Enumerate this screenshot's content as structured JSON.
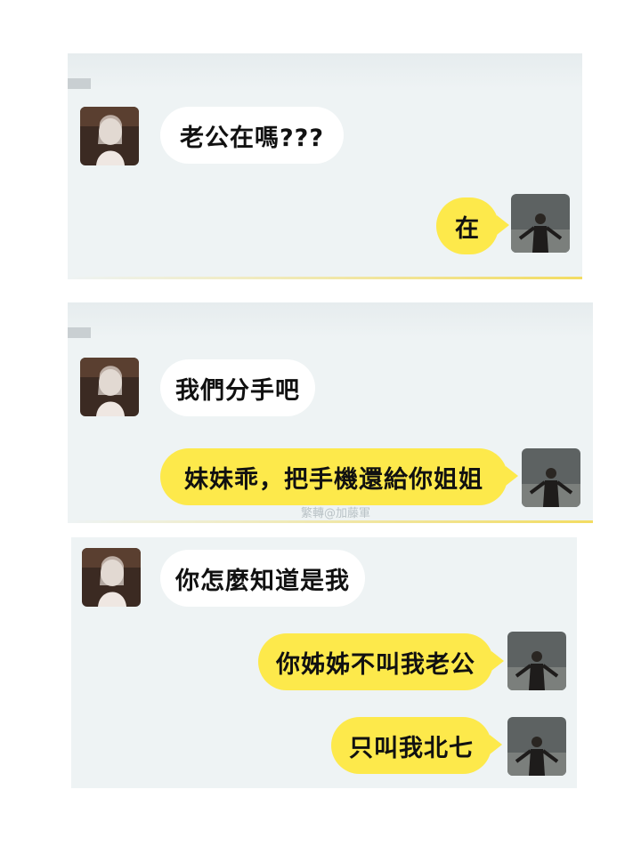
{
  "panels": [
    {
      "messages": [
        {
          "side": "left",
          "text": "老公在嗎???"
        },
        {
          "side": "right",
          "text": "在"
        }
      ]
    },
    {
      "messages": [
        {
          "side": "left",
          "text": "我們分手吧"
        },
        {
          "side": "right",
          "text": "妹妹乖，把手機還給你姐姐"
        }
      ]
    },
    {
      "messages": [
        {
          "side": "left",
          "text": "你怎麼知道是我"
        },
        {
          "side": "right",
          "text": "你姊姊不叫我老公"
        },
        {
          "side": "right",
          "text": "只叫我北七"
        }
      ]
    }
  ],
  "watermark": "繁轉@加藤軍",
  "colors": {
    "panel_bg": "#eef3f4",
    "bubble_self": "#fde94b",
    "bubble_other": "#ffffff"
  },
  "icons": {
    "left_avatar": "girl-avatar-icon",
    "right_avatar": "boy-avatar-icon"
  }
}
